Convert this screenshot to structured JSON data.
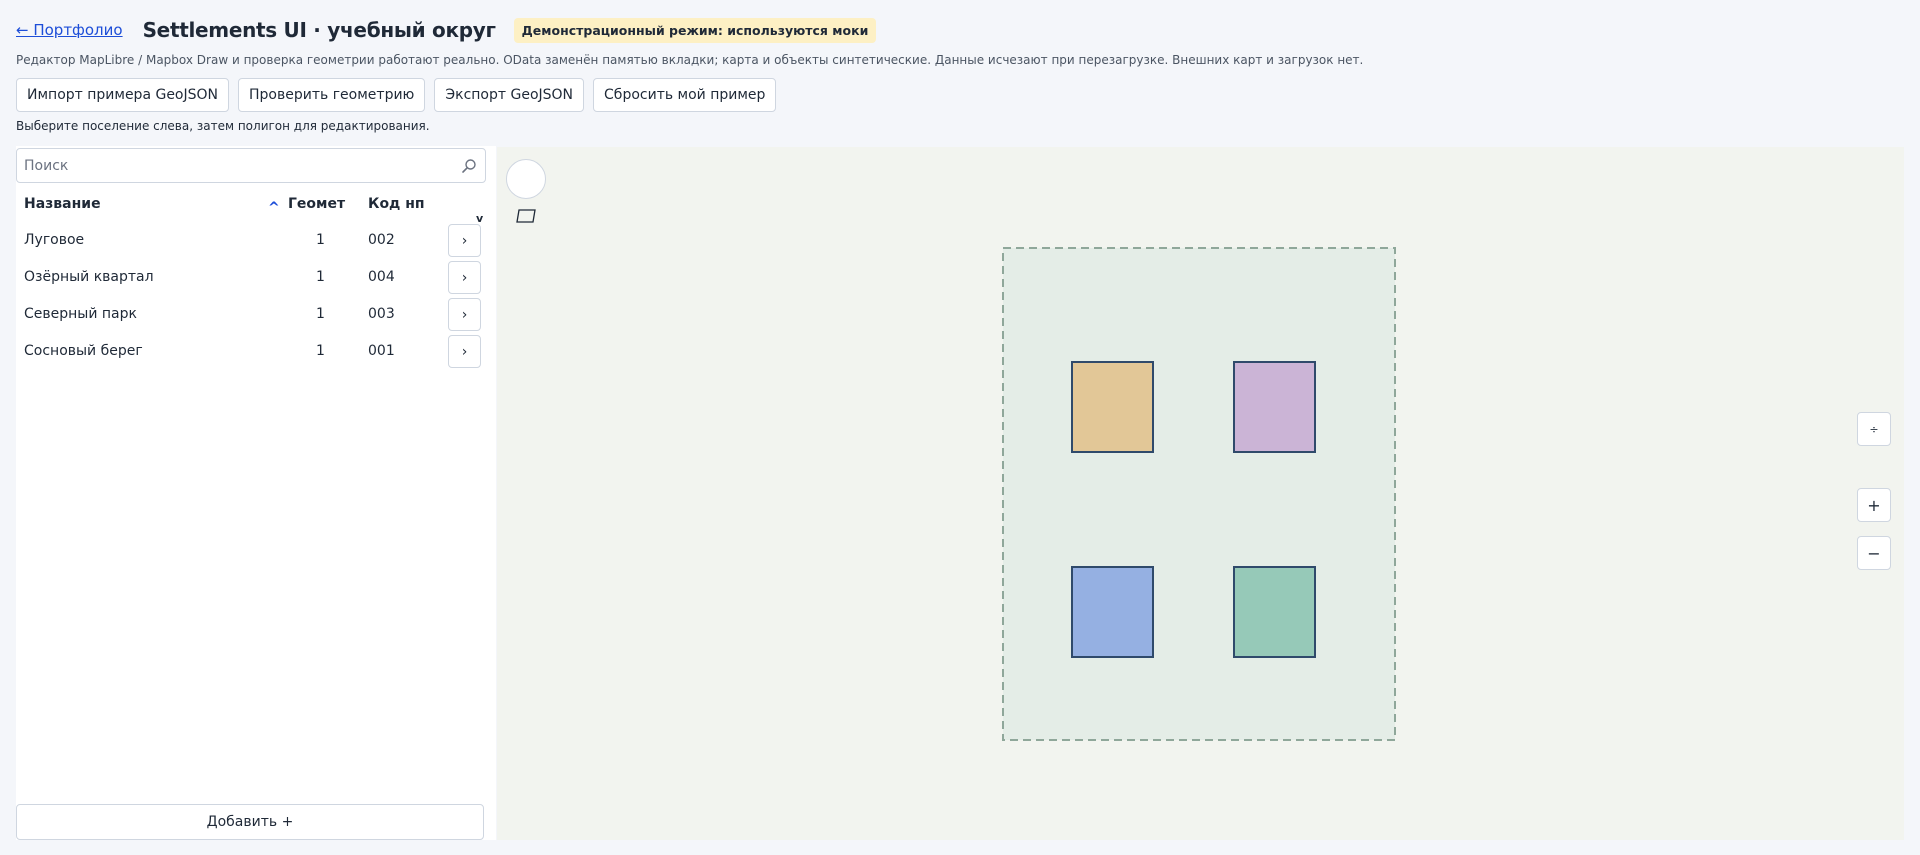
{
  "header": {
    "back_link": "← Портфолио",
    "title": "Settlements UI · учебный округ",
    "badge": "Демонстрационный режим: используются моки"
  },
  "description": "Редактор MapLibre / Mapbox Draw и проверка геометрии работают реально. OData заменён памятью вкладки; карта и объекты синтетические. Данные исчезают при перезагрузке. Внешних карт и загрузок нет.",
  "toolbar": {
    "import_label": "Импорт примера GeoJSON",
    "validate_label": "Проверить геометрию",
    "export_label": "Экспорт GeoJSON",
    "reset_label": "Сбросить мой пример"
  },
  "hint": "Выберите поселение слева, затем полигон для редактирования.",
  "search": {
    "placeholder": "Поиск",
    "icon": "search-icon"
  },
  "table": {
    "columns": [
      "Название",
      "Геомет",
      "Код нп"
    ],
    "sort_indicator": "^",
    "scroll_indicator": "v",
    "rows": [
      {
        "name": "Луговое",
        "geom": "1",
        "code": "002",
        "open": "›"
      },
      {
        "name": "Озёрный квартал",
        "geom": "1",
        "code": "004",
        "open": "›"
      },
      {
        "name": "Северный парк",
        "geom": "1",
        "code": "003",
        "open": "›"
      },
      {
        "name": "Сосновый берег",
        "geom": "1",
        "code": "001",
        "open": "›"
      }
    ]
  },
  "add_button": "Добавить +",
  "map": {
    "background": "#f2f4ef",
    "district_fill": "#e4ede7",
    "district_stroke": "#8fa79a",
    "polygon_stroke": "#2f4a6b",
    "polygon_colors": [
      "#e2c797",
      "#cbb4d6",
      "#95b0e2",
      "#96c9b8"
    ],
    "controls": {
      "compass": "÷",
      "zoom_in": "+",
      "zoom_out": "−"
    }
  }
}
